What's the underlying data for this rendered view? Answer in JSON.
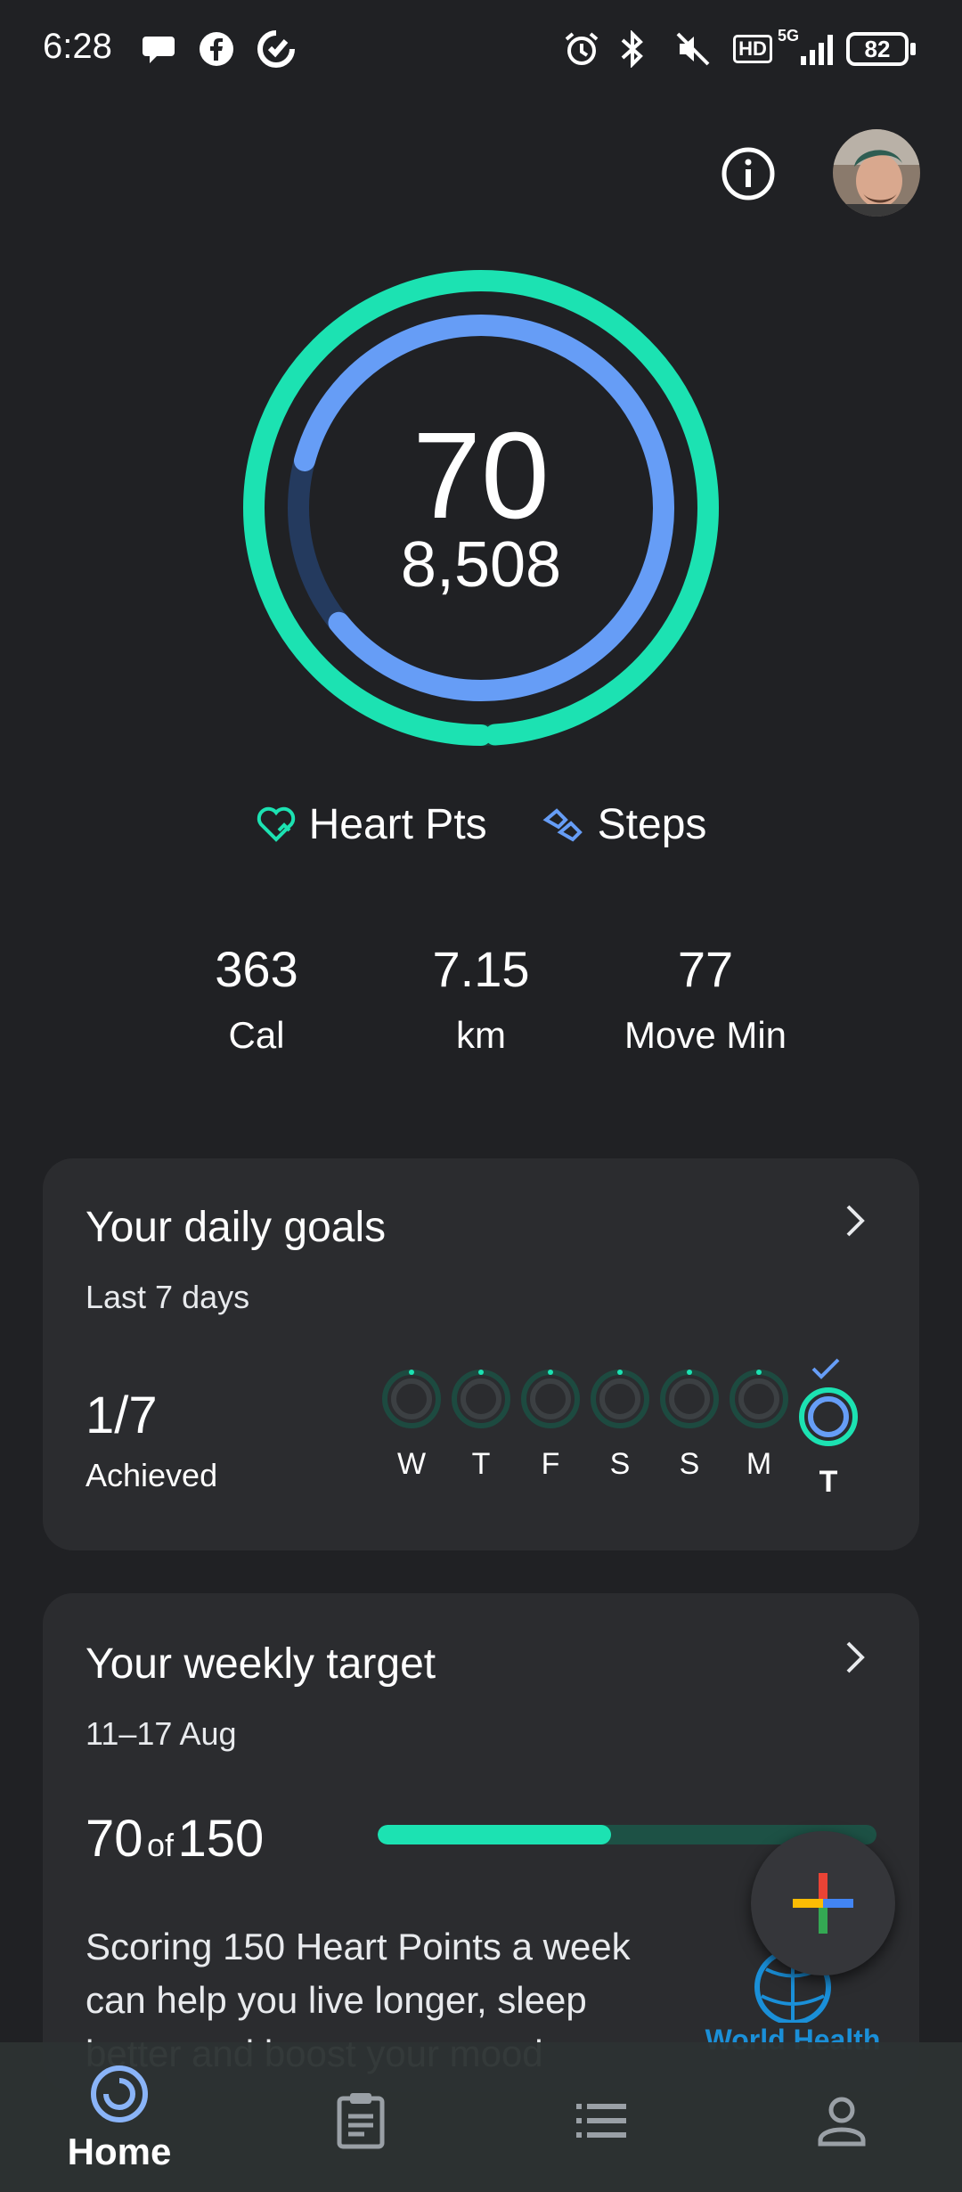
{
  "status_bar": {
    "time": "6:28",
    "battery": "82",
    "network": "5G",
    "hd": "HD",
    "icons": [
      "chat-bubble-icon",
      "facebook-icon",
      "sync-icon",
      "alarm-icon",
      "bluetooth-icon",
      "mute-icon",
      "hd-icon",
      "signal-icon",
      "battery-icon"
    ]
  },
  "header": {
    "info_icon": "info-icon",
    "avatar": "profile-avatar"
  },
  "summary": {
    "heart_points": "70",
    "steps": "8,508",
    "heart_points_progress": 0.99,
    "steps_progress": 0.85,
    "heart_color": "#1ce2b2",
    "steps_color": "#669df6"
  },
  "legend": {
    "heart_label": "Heart Pts",
    "steps_label": "Steps"
  },
  "stats": [
    {
      "value": "363",
      "label": "Cal"
    },
    {
      "value": "7.15",
      "label": "km"
    },
    {
      "value": "77",
      "label": "Move Min"
    }
  ],
  "daily_goals": {
    "title": "Your daily goals",
    "subtitle": "Last 7 days",
    "achieved_value": "1/7",
    "achieved_label": "Achieved",
    "days": [
      "W",
      "T",
      "F",
      "S",
      "S",
      "M",
      "T"
    ],
    "achieved_flags": [
      false,
      false,
      false,
      false,
      false,
      false,
      true
    ]
  },
  "weekly_target": {
    "title": "Your weekly target",
    "date_range": "11–17 Aug",
    "current": "70",
    "of_label": "of",
    "target": "150",
    "progress": 0.467,
    "description": "Scoring 150 Heart Points a week can help you live longer, sleep better and boost your mood",
    "logo_text": "World Health"
  },
  "fab": {
    "icon": "add-icon"
  },
  "bottom_nav": {
    "items": [
      {
        "label": "Home",
        "icon": "home-ring-icon",
        "active": true
      },
      {
        "label": "",
        "icon": "journal-icon",
        "active": false
      },
      {
        "label": "",
        "icon": "browse-list-icon",
        "active": false
      },
      {
        "label": "",
        "icon": "profile-icon",
        "active": false
      }
    ]
  }
}
